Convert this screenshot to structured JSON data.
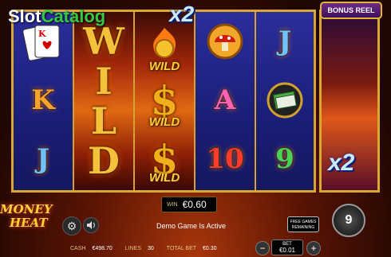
{
  "watermark": {
    "brand_a": "Slot",
    "brand_b": "Catalog"
  },
  "reels": {
    "r1": [
      "K",
      "J"
    ],
    "r2": [
      "W",
      "I",
      "L",
      "D"
    ],
    "r3": {
      "wild_label": "WILD",
      "symbol": "$"
    },
    "r4": [
      "A",
      "10"
    ],
    "r5": [
      "9"
    ]
  },
  "multiplier_top": "x2",
  "bonus_reel": {
    "title": "BONUS REEL",
    "multiplier": "x2"
  },
  "game_logo": {
    "line1": "MONEY",
    "line2": "HEAT"
  },
  "win": {
    "label": "WIN",
    "value": "€0.60"
  },
  "status_message": "Demo Game Is Active",
  "free_games": {
    "line1": "FREE GAMES",
    "line2": "REMAINING"
  },
  "spin_count": "9",
  "bottom": {
    "cash_label": "CASH",
    "cash_value": "€498.70",
    "lines_label": "LINES",
    "lines_value": "30",
    "total_bet_label": "TOTAL BET",
    "total_bet_value": "€0.30"
  },
  "bet": {
    "label": "BET",
    "value": "€0.01",
    "minus": "−",
    "plus": "+"
  },
  "icons": {
    "settings": "gear-icon",
    "sound": "speaker-icon"
  },
  "colors": {
    "reel_blue": "#1c1f7a",
    "gold": "#d9a833",
    "fire": "#e16a13"
  }
}
